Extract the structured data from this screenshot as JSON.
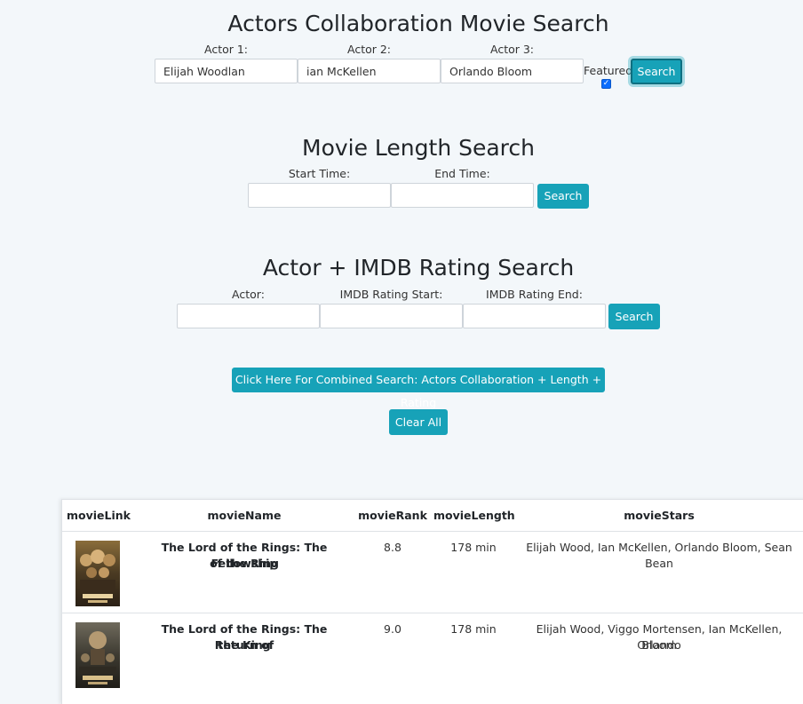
{
  "actors_search": {
    "title": "Actors Collaboration Movie Search",
    "actor1_label": "Actor 1:",
    "actor2_label": "Actor 2:",
    "actor3_label": "Actor 3:",
    "actor1_value": "Elijah Woodlan",
    "actor2_value": "ian McKellen",
    "actor3_value": "Orlando Bloom",
    "featured_label": "Featured",
    "featured_checked": true,
    "search_button": "Search"
  },
  "length_search": {
    "title": "Movie Length Search",
    "start_label": "Start Time:",
    "end_label": "End Time:",
    "start_value": "",
    "end_value": "",
    "search_button": "Search"
  },
  "rating_search": {
    "title": "Actor + IMDB Rating Search",
    "actor_label": "Actor:",
    "rating_start_label": "IMDB Rating Start:",
    "rating_end_label": "IMDB Rating End:",
    "actor_value": "",
    "rating_start_value": "",
    "rating_end_value": "",
    "search_button": "Search"
  },
  "combined_button": "Click Here For Combined Search: Actors Collaboration + Length + Rating",
  "clear_button": "Clear All",
  "results_table": {
    "columns": [
      "movieLink",
      "movieName",
      "movieRank",
      "movieLength",
      "movieStars"
    ],
    "rows": [
      {
        "poster": "fellowship-poster",
        "name_line1": "The Lord of the Rings: The Fellowship",
        "name_line2": "of the Ring",
        "rank": "8.8",
        "length": "178 min",
        "stars_line1": "Elijah Wood, Ian McKellen, Orlando Bloom, Sean Bean",
        "stars_line2": ""
      },
      {
        "poster": "return-of-the-king-poster",
        "name_line1": "The Lord of the Rings: The Return of",
        "name_line2": "the King",
        "rank": "9.0",
        "length": "178 min",
        "stars_line1": "Elijah Wood, Viggo Mortensen, Ian McKellen, Orlando",
        "stars_line2": "Bloom"
      }
    ]
  },
  "colors": {
    "background": "#f3f7fa",
    "button": "#17a2b8",
    "text": "#212529"
  }
}
